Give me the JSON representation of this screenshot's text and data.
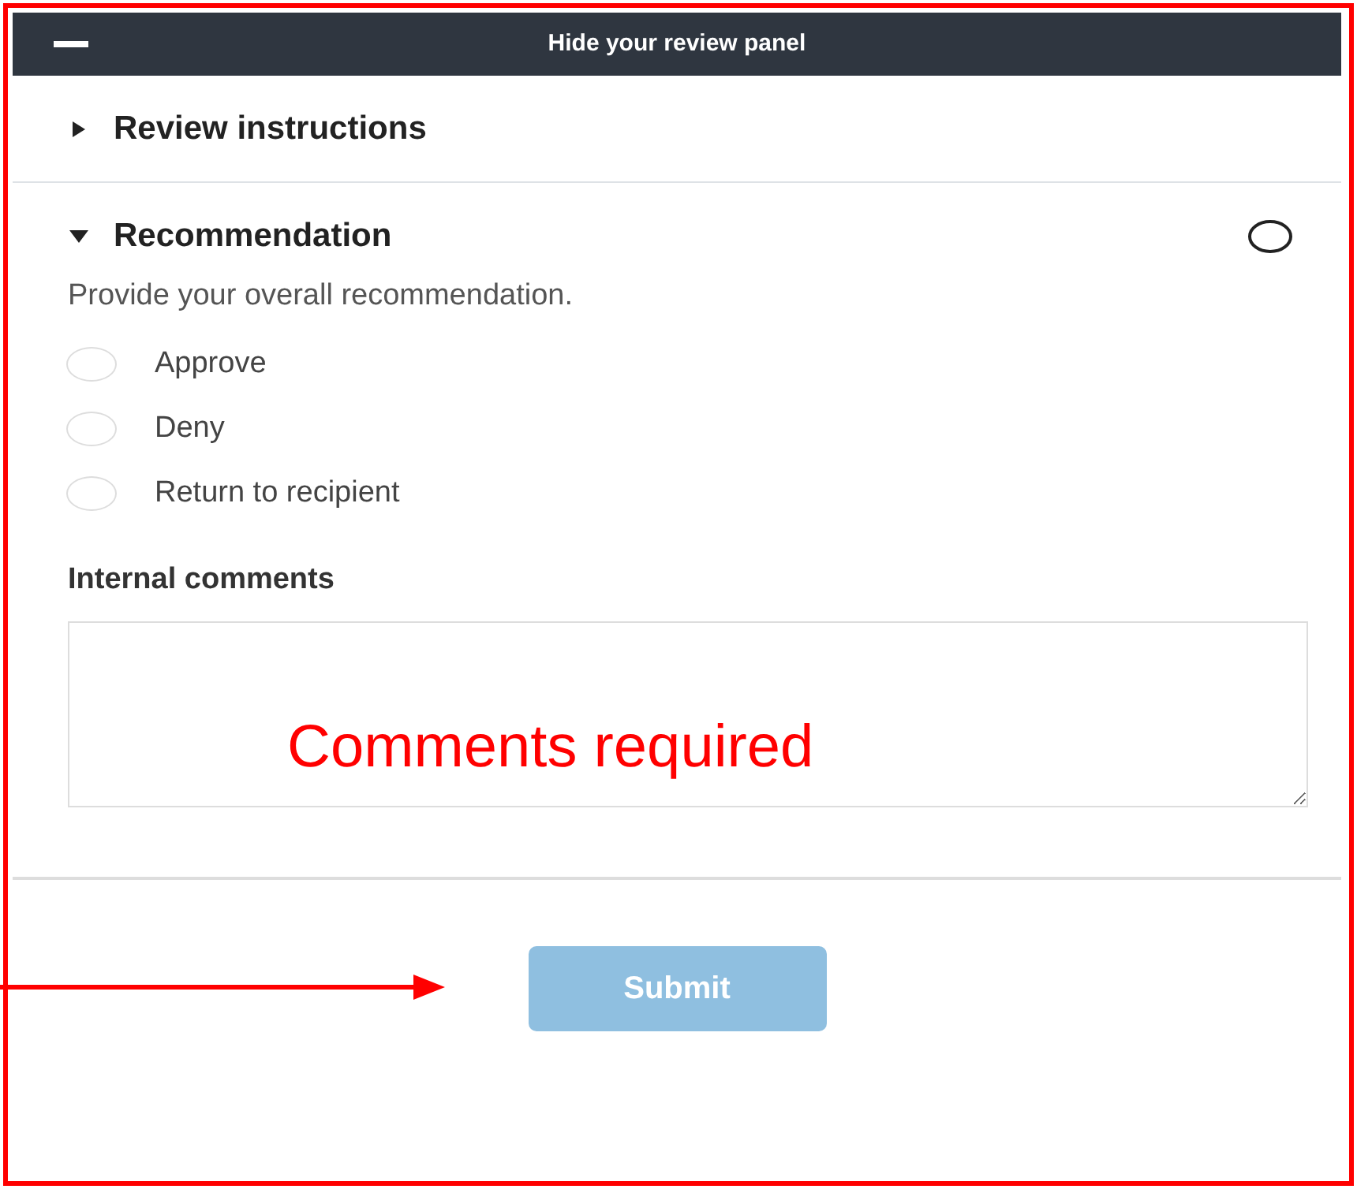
{
  "panel": {
    "header": {
      "title": "Hide your review panel"
    },
    "sections": [
      {
        "title": "Review instructions",
        "expanded": false
      },
      {
        "title": "Recommendation",
        "expanded": true,
        "complete": false
      }
    ],
    "prompt": "Provide your overall recommendation.",
    "options": [
      {
        "label": "Approve",
        "selected": false
      },
      {
        "label": "Deny",
        "selected": false
      },
      {
        "label": "Return to recipient",
        "selected": false
      }
    ],
    "comments_label": "Internal comments",
    "submit": {
      "label": "Submit",
      "disabled": true
    }
  },
  "annotation": {
    "note": "Comments required"
  }
}
